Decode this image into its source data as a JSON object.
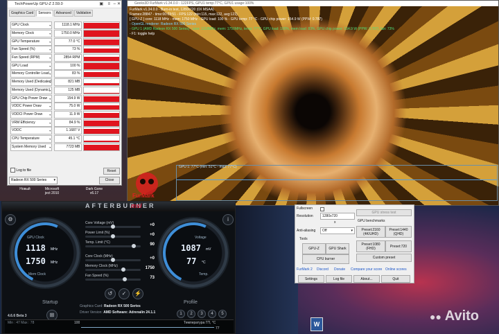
{
  "gpuz": {
    "title": "TechPowerUp GPU-Z 2.59.0",
    "tabs": [
      "Graphics Card",
      "Sensors",
      "Advanced",
      "Validation"
    ],
    "active_tab": "Sensors",
    "sensors": [
      {
        "label": "GPU Clock",
        "value": "1118.1 MHz",
        "level": 0.95
      },
      {
        "label": "Memory Clock",
        "value": "1750.0 MHz",
        "level": 0.95
      },
      {
        "label": "GPU Temperature",
        "value": "77.0 °C",
        "level": 0.9
      },
      {
        "label": "Fan Speed (%)",
        "value": "73 %",
        "level": 0.7
      },
      {
        "label": "Fan Speed (RPM)",
        "value": "2854 RPM",
        "level": 0.7
      },
      {
        "label": "GPU Load",
        "value": "100 %",
        "level": 0.95
      },
      {
        "label": "Memory Controller Load",
        "value": "83 %",
        "level": 0.8
      },
      {
        "label": "Memory Used (Dedicated)",
        "value": "821 MB",
        "level": 0.35
      },
      {
        "label": "Memory Used (Dynamic)",
        "value": "125 MB",
        "level": 0.1
      },
      {
        "label": "GPU Chip Power Draw",
        "value": "154.9 W",
        "level": 0.85
      },
      {
        "label": "VDDC Power Draw",
        "value": "75.0 W",
        "level": 0.7
      },
      {
        "label": "VDDCI Power Draw",
        "value": "11.9 W",
        "level": 0.75
      },
      {
        "label": "VRM Efficiency",
        "value": "84.9 %",
        "level": 0.8
      },
      {
        "label": "VDDC",
        "value": "1.1687 V",
        "level": 0.85
      },
      {
        "label": "CPU Temperature",
        "value": "45.1 °C",
        "level": 0.25
      },
      {
        "label": "System Memory Used",
        "value": "7723 MB",
        "level": 0.9
      }
    ],
    "log_to_file": "Log to file",
    "reset_label": "Reset",
    "gpu_select": "Radeon RX 500 Series",
    "close_label": "Close"
  },
  "desktop_icons": [
    "Новый",
    "Microsoft",
    "Dark Gone"
  ],
  "desktop_icon_sub": "ject 2010",
  "desktop_icon_sub2": "v6.17",
  "furmark": {
    "window_title": "Geeks3D FurMark v1.34.0.0 - 122FPS, GPU1 temp:77°C, GPU1 usage:100%",
    "hud": [
      {
        "text": "FurMark v1.34.0.0 - Burn-in test, 1280x720 (0X MSAA)",
        "color": "#ffffff"
      },
      {
        "text": "Frames:28847 - time:00:03:51 - FPS:122 (min:115, max:122, avg:121)",
        "color": "#ffffff"
      },
      {
        "text": "[ GPU-Z ] core: 1118 MHz - mem: 1750 MHz - GPU load: 100 % - GPU temp: 77 °C - GPU chip power: 154.9 W (PPW: 0.787)",
        "color": "#ffffff"
      },
      {
        "text": "- OpenGL renderer: Radeon RX 500 Series",
        "color": "#7fd7ff"
      },
      {
        "text": "- GPU 1 (AMD Radeon RX 500 Series) - core: 1118MHz, mem: 1750MHz, temp: 77°C, GPU load: 100%, mem load: 83%, GPU chip power: 154.9 W (PPW: 0.787), fan: 73%",
        "color": "#4fe07a"
      },
      {
        "text": "- F1: toggle help",
        "color": "#ffffff"
      }
    ],
    "graph_label": "GPU 1: 77°C (min: 51°C - max: 77°C)",
    "logo": "FurMark"
  },
  "afterburner": {
    "brand": "AFTERBURNER",
    "vendor": "msi",
    "left_gauge": {
      "top_label": "GPU Clock",
      "value1": "1118",
      "unit1": "MHz",
      "value2": "1750",
      "unit2": "MHz",
      "bottom_label": "Mem Clock"
    },
    "right_gauge": {
      "top_label": "Voltage",
      "value1": "1087",
      "unit1": "mV",
      "value2": "77",
      "unit2": "°C",
      "bottom_label": "Temp."
    },
    "sliders": [
      {
        "name": "Core Voltage (mV)",
        "value": "+0",
        "level": 0.5
      },
      {
        "name": "Power Limit (%)",
        "value": "+0",
        "level": 0.5
      },
      {
        "name": "Temp. Limit (°C)",
        "value": "90",
        "level": 0.9
      },
      {
        "name": "Core Clock (MHz)",
        "value": "+0",
        "level": 0.5
      },
      {
        "name": "Memory Clock (MHz)",
        "value": "1750",
        "level": 0.7
      },
      {
        "name": "Fan Speed (%)",
        "value": "73",
        "level": 0.73
      }
    ],
    "startup_label": "Startup",
    "profile_label": "Profile",
    "graphics_card_label": "Graphics Card:",
    "graphics_card": "Radeon RX 500 Series",
    "driver_label": "Driver Version:",
    "driver": "AMD Software: Adrenalin 24.1.1",
    "version": "4.6.6 Beta 3",
    "min_max": "Min : 47   Max : 78",
    "monitor_title": "Температура ГП, °C",
    "monitor_value": "77",
    "monitor_max": "100"
  },
  "furmark2": {
    "fullscreen_label": "Fullscreen",
    "resolution_label": "Resolution",
    "resolution_value": "1280x720",
    "x_label": "x",
    "aa_label": "Anti-aliasing",
    "aa_value": "Off",
    "tools_label": "Tools",
    "gpuz_btn": "GPU-Z",
    "gpushark_btn": "GPU Shark",
    "cpuburner_btn": "CPU burner",
    "stress_btn": "GPU stress test",
    "benchmarks_label": "GPU benchmarks",
    "preset_2160": "Preset:2160 (4K/UHD)",
    "preset_1440": "Preset:1440 (QHD)",
    "preset_1080": "Preset:1080 (FHD)",
    "preset_720": "Preset:720",
    "custom_preset": "Custom preset",
    "links": [
      "FurMark 2",
      "Discord",
      "Donate",
      "Compare your score",
      "Online scores"
    ],
    "settings_btn": "Settings",
    "logfile_btn": "Log file",
    "about_btn": "About...",
    "quit_btn": "Quit"
  },
  "watermark": "Avito"
}
